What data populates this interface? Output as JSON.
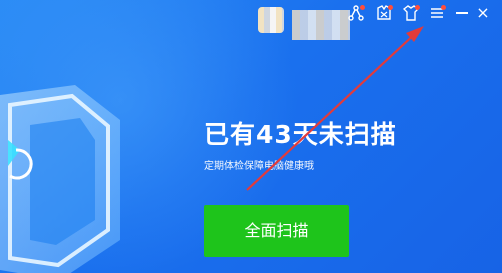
{
  "header": {
    "icons": [
      {
        "name": "share-icon"
      },
      {
        "name": "clothes-icon"
      },
      {
        "name": "shirt-icon"
      },
      {
        "name": "menu-icon"
      },
      {
        "name": "minimize-icon"
      },
      {
        "name": "close-icon"
      }
    ],
    "close_glyph": "×"
  },
  "main": {
    "title": "已有43天未扫描",
    "subtitle": "定期体检保障电脑健康哦",
    "scan_button_label": "全面扫描"
  },
  "colors": {
    "background": "#1a70ee",
    "button": "#1ec41b",
    "arrow": "#e23b3b",
    "badge": "#ff4d3a"
  }
}
